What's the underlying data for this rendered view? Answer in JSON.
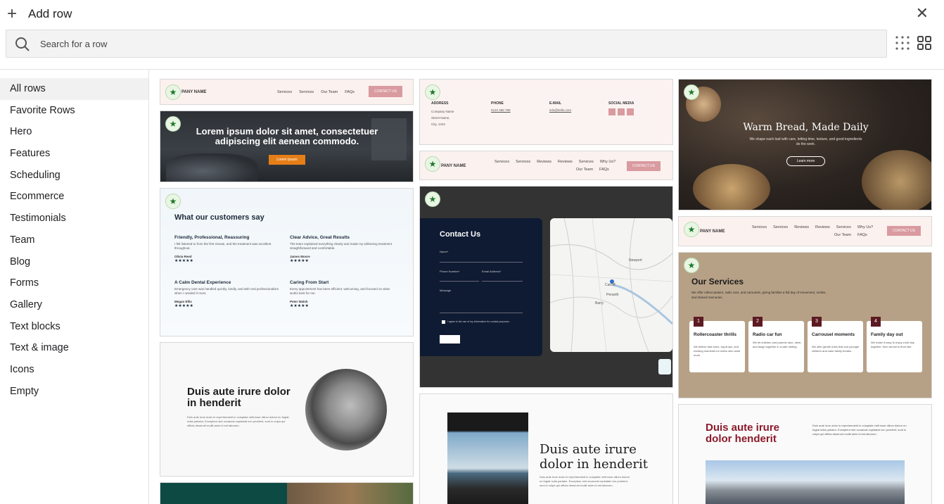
{
  "header": {
    "title": "Add row"
  },
  "search": {
    "placeholder": "Search for a row"
  },
  "sidebar": {
    "items": [
      {
        "label": "All rows"
      },
      {
        "label": "Favorite Rows"
      },
      {
        "label": "Hero"
      },
      {
        "label": "Features"
      },
      {
        "label": "Scheduling"
      },
      {
        "label": "Ecommerce"
      },
      {
        "label": "Testimonials"
      },
      {
        "label": "Team"
      },
      {
        "label": "Blog"
      },
      {
        "label": "Forms"
      },
      {
        "label": "Gallery"
      },
      {
        "label": "Text blocks"
      },
      {
        "label": "Text & image"
      },
      {
        "label": "Icons"
      },
      {
        "label": "Empty"
      }
    ]
  },
  "cards": {
    "nav1": {
      "logo": "PANY NAME",
      "links": [
        "Services",
        "Services",
        "Our Team",
        "FAQs"
      ],
      "button": "CONTACT US"
    },
    "hero_car": {
      "heading": "Lorem ipsum dolor sit amet, consectetuer adipiscing elit aenean commodo.",
      "button": "Lorem Ipsum"
    },
    "testimonials": {
      "heading": "What our customers say",
      "items": [
        {
          "title": "Friendly, Professional, Reassuring",
          "body": "I felt listened to from the first minute, and the treatment was excellent throughout.",
          "name": "Olivia Reed"
        },
        {
          "title": "Clear Advice, Great Results",
          "body": "The team explained everything clearly and made my whitening treatment straightforward and comfortable.",
          "name": "James Moore"
        },
        {
          "title": "A Calm Dental Experience",
          "body": "Emergency care was handled quickly, kindly, and with real professionalism when I needed it most.",
          "name": "Megan Ellis"
        },
        {
          "title": "Caring From Start",
          "body": "Every appointment has been efficient, welcoming, and focused on what works best for me.",
          "name": "Peter Walsh"
        }
      ],
      "stars": "★★★★★"
    },
    "coffee_machine": {
      "heading": "Duis aute irure dolor in henderit",
      "body": "Duis aute irure dolor in reprehenderit in voluptate velit esse cillum dolore eu fugiat nulla pariatur. Excepteur sint occaecat cupidatat non proident, sunt in culpa qui officia deserunt mollit anim id est laborum."
    },
    "contact_info": {
      "cols": [
        {
          "label": "ADDRESS",
          "value": "Company Name\nStreet Name,\nCity, 1234"
        },
        {
          "label": "PHONE",
          "value": "0123 456 789"
        },
        {
          "label": "E-MAIL",
          "value": "info@hello.com"
        },
        {
          "label": "SOCIAL MEDIA",
          "value": ""
        }
      ]
    },
    "nav2": {
      "logo": "PANY NAME",
      "links": [
        "Services",
        "Services",
        "Reviews",
        "Reviews",
        "Services",
        "Why Us?"
      ],
      "links2": [
        "Our Team",
        "FAQs"
      ],
      "button": "CONTACT US"
    },
    "contact_form": {
      "heading": "Contact Us",
      "name_label": "Name*",
      "phone_label": "Phone Number*",
      "email_label": "Email Address*",
      "message_label": "Message",
      "consent": "I agree to the use of my information for contact purposes.",
      "map_labels": [
        "Newport",
        "Cardiff",
        "Penarth",
        "Barry"
      ]
    },
    "van": {
      "heading": "Duis aute irure dolor in henderit",
      "body": "Duis aute irure dolor in reprehenderit in voluptate velit esse cillum dolore eu fugiat nulla pariatur. Excepteur sint occaecat cupidatat non proident, sunt in culpa qui officia deserunt mollit anim id est laborum."
    },
    "bakery": {
      "heading": "Warm Bread, Made Daily",
      "sub": "We shape each loaf with care, letting time, texture, and good ingredients do the work.",
      "button": "Learn more"
    },
    "nav3": {
      "logo": "PANY NAME",
      "links": [
        "Services",
        "Services",
        "Reviews",
        "Reviews",
        "Services",
        "Why Us?"
      ],
      "links2": [
        "Our Team",
        "FAQs"
      ],
      "button": "CONTACT US"
    },
    "services": {
      "heading": "Our Services",
      "sub": "We offer rollercoasters, radio cars, and carousels, giving families a full day of movement, smiles, and shared memories.",
      "items": [
        {
          "num": "1",
          "title": "Rollercoaster thrills",
          "body": "We deliver fast turns, big drops, and exciting moments for riders who want more."
        },
        {
          "num": "2",
          "title": "Radio car fun",
          "body": "We let children and parents race, steer, and laugh together in a safe setting."
        },
        {
          "num": "3",
          "title": "Carrousel moments",
          "body": "We offer gentle rides that suit younger children and calm family breaks."
        },
        {
          "num": "4",
          "title": "Family day out",
          "body": "We make it easy to enjoy a full day together, from arrival to final ride."
        }
      ]
    },
    "mountains": {
      "heading": "Duis aute irure dolor henderit",
      "body": "Duis aute irure dolor in reprehenderit in voluptate velit esse cillum dolore eu fugiat nulla pariatur. Excepteur sint occaecat cupidatat non proident, sunt in culpa qui officia deserunt mollit anim id est laborum."
    }
  },
  "colors": {
    "accent_pink": "#d99aa0",
    "navbar_bg": "#fbf1ee",
    "star_green": "#1e7a2a",
    "services_bg": "#b7a186",
    "maroon": "#8b1a2b",
    "contact_navy": "#0f1b33",
    "bakery_bg": "#2b2420"
  }
}
